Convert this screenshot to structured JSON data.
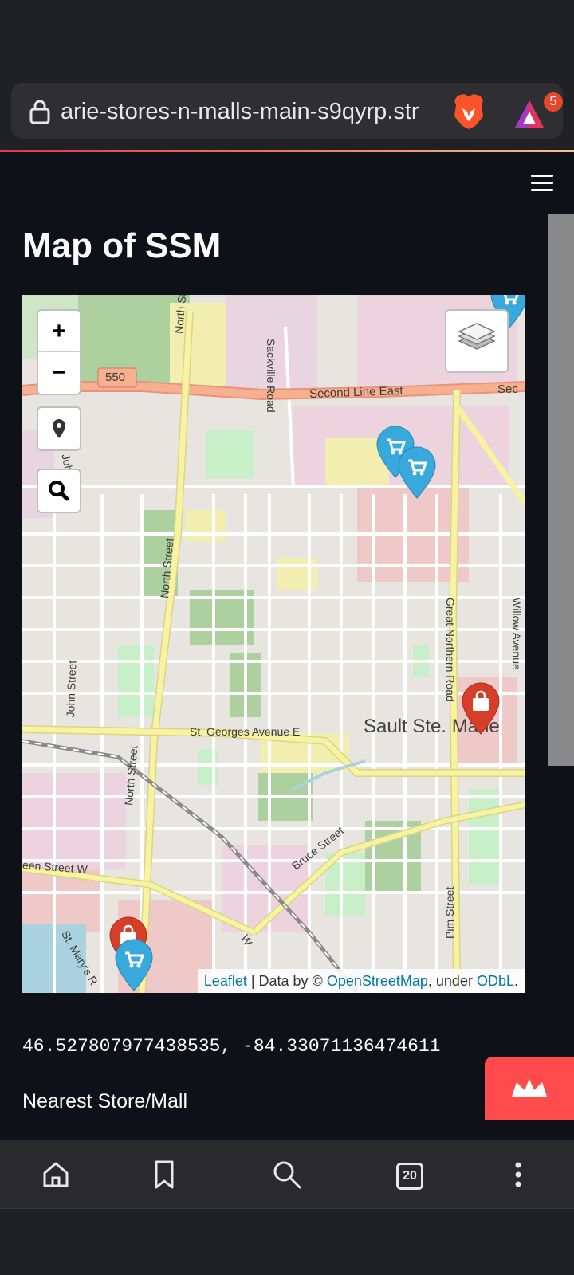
{
  "browser": {
    "url": "arie-stores-n-malls-main-s9qyrp.str",
    "rewards_count": "5",
    "tab_count": "20"
  },
  "page": {
    "title": "Map of SSM",
    "coordinates": "46.527807977438535, -84.33071136474611",
    "nearest_label": "Nearest Store/Mall"
  },
  "map": {
    "zoom_in": "+",
    "zoom_out": "−",
    "attribution": {
      "leaflet": "Leaflet",
      "data_by": " | Data by © ",
      "osm": "OpenStreetMap",
      "under": ", under ",
      "odbl": "ODbL",
      "end": "."
    },
    "labels": {
      "road_550": "550",
      "second_line_east": "Second Line East",
      "second_line_east_cut": "Sec",
      "north_street_top": "North Street",
      "sackville_road": "Sackville Road",
      "john_street_top": "John Street",
      "north_street_mid": "North Street",
      "great_northern_road": "Great Northern Road",
      "willow_avenue": "Willow Avenue",
      "john_street_low": "John Street",
      "st_georges_avenue": "St. Georges Avenue E",
      "city_name": "Sault Ste. Marie",
      "north_street_low": "North Street",
      "bruce_street": "Bruce Street",
      "queen_street": "een Street W",
      "st_marys": "St. Mary's R",
      "pim_street": "Pim Street",
      "w_fragment": "W"
    },
    "markers": [
      {
        "kind": "store",
        "color": "#38a9dc",
        "icon": "shopping-cart-icon"
      },
      {
        "kind": "store",
        "color": "#38a9dc",
        "icon": "shopping-cart-icon"
      },
      {
        "kind": "store",
        "color": "#38a9dc",
        "icon": "shopping-cart-icon"
      },
      {
        "kind": "mall",
        "color": "#d63e2a",
        "icon": "shopping-bag-icon"
      },
      {
        "kind": "mall",
        "color": "#d63e2a",
        "icon": "shopping-bag-icon"
      },
      {
        "kind": "store",
        "color": "#38a9dc",
        "icon": "shopping-cart-icon"
      }
    ]
  },
  "colors": {
    "page_bg": "#0e1117",
    "browser_bg": "#202124",
    "accent": "#ff4b4b",
    "store_marker": "#38a9dc",
    "mall_marker": "#d63e2a"
  }
}
